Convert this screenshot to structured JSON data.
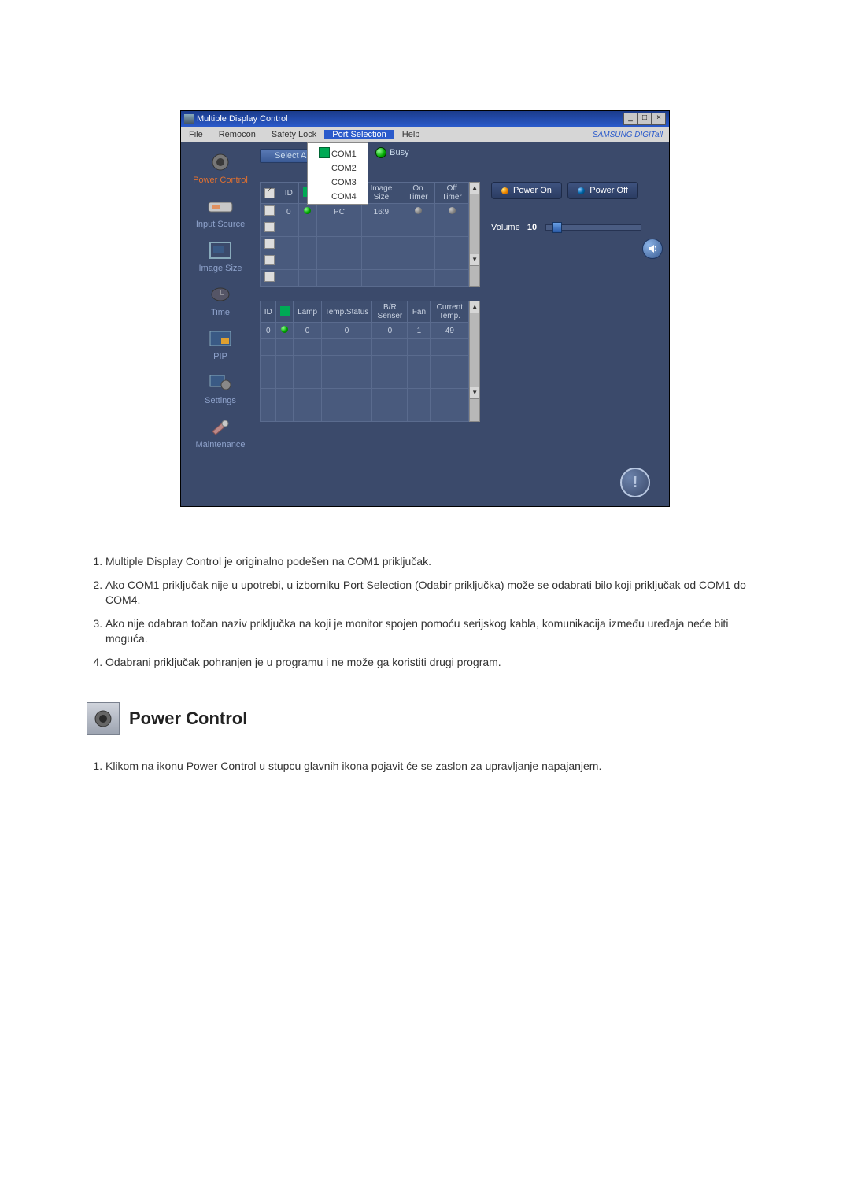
{
  "screenshot": {
    "window": {
      "title": "Multiple Display Control",
      "win_min": "_",
      "win_max": "□",
      "win_close": "×"
    },
    "menubar": {
      "items": [
        "File",
        "Remocon",
        "Safety Lock",
        "Port Selection",
        "Help"
      ],
      "brand": "SAMSUNG DIGITall"
    },
    "port_dropdown": {
      "items": [
        "COM1",
        "COM2",
        "COM3",
        "COM4"
      ],
      "checked_index": 0
    },
    "sidebar": {
      "items": [
        {
          "label": "Power Control",
          "active": true
        },
        {
          "label": "Input Source"
        },
        {
          "label": "Image Size"
        },
        {
          "label": "Time"
        },
        {
          "label": "PIP"
        },
        {
          "label": "Settings"
        },
        {
          "label": "Maintenance"
        }
      ]
    },
    "center": {
      "select_all": "Select All",
      "busy": "Busy",
      "table1": {
        "headers": [
          "",
          "ID",
          "",
          "",
          "Image Size",
          "On Timer",
          "Off Timer"
        ],
        "rows": [
          {
            "checked": true,
            "cells": [
              "",
              "",
              "",
              "",
              "",
              ""
            ]
          },
          {
            "checked": false,
            "cells": [
              "0",
              "●",
              "PC",
              "16:9",
              "○",
              "○"
            ]
          },
          {
            "checked": false,
            "cells": [
              "",
              "",
              "",
              "",
              "",
              ""
            ]
          },
          {
            "checked": false,
            "cells": [
              "",
              "",
              "",
              "",
              "",
              ""
            ]
          },
          {
            "checked": false,
            "cells": [
              "",
              "",
              "",
              "",
              "",
              ""
            ]
          },
          {
            "checked": false,
            "cells": [
              "",
              "",
              "",
              "",
              "",
              ""
            ]
          }
        ]
      },
      "table2": {
        "headers": [
          "ID",
          "",
          "Lamp",
          "Temp.Status",
          "B/R Senser",
          "Fan",
          "Current Temp."
        ],
        "rows": [
          {
            "cells": [
              "0",
              "●",
              "0",
              "0",
              "0",
              "1",
              "49"
            ]
          },
          {
            "cells": [
              "",
              "",
              "",
              "",
              "",
              "",
              ""
            ]
          },
          {
            "cells": [
              "",
              "",
              "",
              "",
              "",
              "",
              ""
            ]
          },
          {
            "cells": [
              "",
              "",
              "",
              "",
              "",
              "",
              ""
            ]
          },
          {
            "cells": [
              "",
              "",
              "",
              "",
              "",
              "",
              ""
            ]
          },
          {
            "cells": [
              "",
              "",
              "",
              "",
              "",
              "",
              ""
            ]
          }
        ]
      }
    },
    "right": {
      "power_on": "Power On",
      "power_off": "Power Off",
      "volume_label": "Volume",
      "volume_value": "10"
    },
    "info_icon": "!"
  },
  "text_list": {
    "items": [
      "Multiple Display Control je originalno podešen na COM1 priključak.",
      "Ako COM1 priključak nije u upotrebi, u izborniku Port Selection (Odabir priključka) može se odabrati bilo koji priključak od COM1 do COM4.",
      "Ako nije odabran točan naziv priključka na koji je monitor spojen pomoću serijskog kabla, komunikacija između uređaja neće biti moguća.",
      "Odabrani priključak pohranjen je u programu i ne može ga koristiti drugi program."
    ]
  },
  "section": {
    "heading": "Power Control",
    "list": {
      "items": [
        "Klikom na ikonu Power Control u stupcu glavnih ikona pojavit će se zaslon za upravljanje napajanjem."
      ]
    }
  }
}
